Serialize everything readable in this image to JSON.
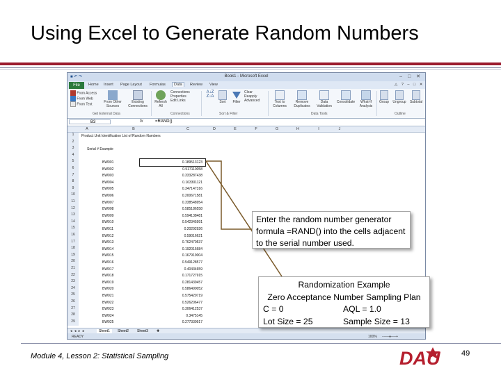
{
  "slide": {
    "title": "Using Excel to Generate Random Numbers",
    "footer": "Module 4, Lesson 2: Statistical Sampling",
    "page_number": "49",
    "logo_text": "DAU"
  },
  "excel": {
    "window_title": "Book1 - Microsoft Excel",
    "tabs": [
      "File",
      "Home",
      "Insert",
      "Page Layout",
      "Formulas",
      "Data",
      "Review",
      "View"
    ],
    "active_tab": "Data",
    "ribbon": {
      "get_external_data": {
        "items": [
          "From Access",
          "From Web",
          "From Text"
        ],
        "other_sources": "From Other Sources",
        "existing_connections": "Existing Connections",
        "label": "Get External Data"
      },
      "connections": {
        "refresh_all": "Refresh All",
        "items": [
          "Connections",
          "Properties",
          "Edit Links"
        ],
        "label": "Connections"
      },
      "sort_filter": {
        "sort": "Sort",
        "filter": "Filter",
        "items": [
          "Clear",
          "Reapply",
          "Advanced"
        ],
        "label": "Sort & Filter"
      },
      "data_tools": {
        "text_to_columns": "Text to Columns",
        "remove_duplicates": "Remove Duplicates",
        "data_validation": "Data Validation",
        "consolidate": "Consolidate",
        "what_if": "What-If Analysis",
        "label": "Data Tools"
      },
      "outline": {
        "items": [
          "Group",
          "Ungroup",
          "Subtotal"
        ],
        "label": "Outline"
      }
    },
    "name_box": "B3",
    "formula": "=RAND()",
    "columns": [
      "A",
      "B",
      "C",
      "D",
      "E",
      "F",
      "G",
      "H",
      "I",
      "J"
    ],
    "header_cell": "Product Unit Identification  List of Random Numbers",
    "serial_example": "Serial # Example",
    "rows": [
      {
        "id": "BW001",
        "rand": "0.189513123"
      },
      {
        "id": "BW002",
        "rand": "0.517110058"
      },
      {
        "id": "BW003",
        "rand": "0.333287438"
      },
      {
        "id": "BW004",
        "rand": "0.163301121"
      },
      {
        "id": "BW005",
        "rand": "0.347147316"
      },
      {
        "id": "BW006",
        "rand": "0.200671581"
      },
      {
        "id": "BW007",
        "rand": "0.338548954"
      },
      {
        "id": "BW008",
        "rand": "0.585186558"
      },
      {
        "id": "BW009",
        "rand": "0.594138481"
      },
      {
        "id": "BW010",
        "rand": "0.542345991"
      },
      {
        "id": "BW011",
        "rand": "0.20292926"
      },
      {
        "id": "BW012",
        "rand": "0.59016621"
      },
      {
        "id": "BW013",
        "rand": "0.762470537"
      },
      {
        "id": "BW014",
        "rand": "0.192015684"
      },
      {
        "id": "BW015",
        "rand": "0.167919004"
      },
      {
        "id": "BW016",
        "rand": "0.549128577"
      },
      {
        "id": "BW017",
        "rand": "0.40434659"
      },
      {
        "id": "BW018",
        "rand": "0.171727915"
      },
      {
        "id": "BW019",
        "rand": "0.281439457"
      },
      {
        "id": "BW020",
        "rand": "0.586490052"
      },
      {
        "id": "BW021",
        "rand": "0.575420719"
      },
      {
        "id": "BW022",
        "rand": "0.526206477"
      },
      {
        "id": "BW023",
        "rand": "0.306412537"
      },
      {
        "id": "BW024",
        "rand": "0.3475145"
      },
      {
        "id": "BW025",
        "rand": "0.277330917"
      }
    ],
    "sheet_tabs": [
      "Sheet1",
      "Sheet2",
      "Sheet3"
    ],
    "status": "READY",
    "zoom": "100%"
  },
  "callouts": {
    "formula_note": "Enter the random number generator formula =RAND() into the cells adjacent to the serial number used.",
    "example_title": "Randomization Example",
    "example_subtitle": "Zero Acceptance Number Sampling Plan",
    "c_label": "C = 0",
    "aql_label": "AQL = 1.0",
    "lot_label": "Lot Size = 25",
    "sample_label": "Sample Size = 13"
  },
  "colors": {
    "accent": "#9b1b2e",
    "excel_file_tab": "#2b7a3d",
    "connector": "#7a5a2a"
  }
}
